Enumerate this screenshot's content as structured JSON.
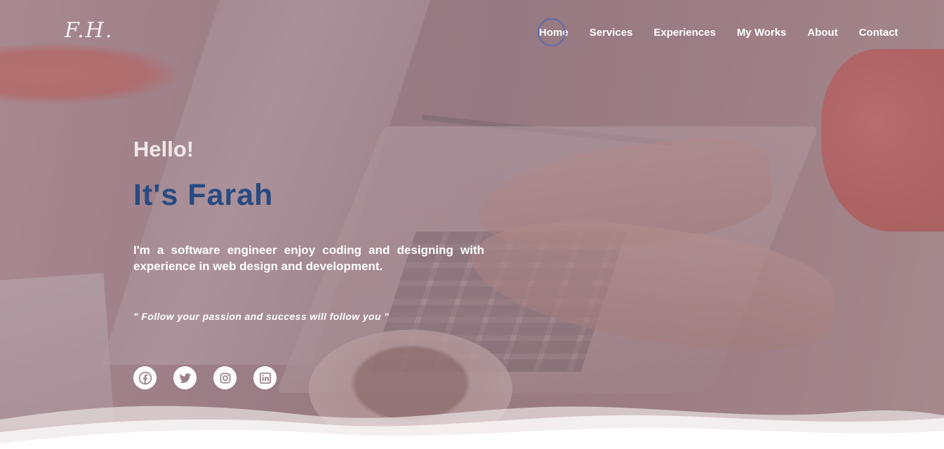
{
  "header": {
    "logo": "F.H.",
    "nav": [
      {
        "label": "Home",
        "active": true
      },
      {
        "label": "Services"
      },
      {
        "label": "Experiences"
      },
      {
        "label": "My Works"
      },
      {
        "label": "About"
      },
      {
        "label": "Contact"
      }
    ]
  },
  "hero": {
    "greeting": "Hello!",
    "name": "It's Farah",
    "intro": "I'm a software engineer enjoy coding and designing with experience in web design and development.",
    "quote": "\" Follow your passion and success will follow you \""
  },
  "socials": [
    {
      "icon": "facebook-icon"
    },
    {
      "icon": "twitter-icon"
    },
    {
      "icon": "instagram-icon"
    },
    {
      "icon": "linkedin-icon"
    }
  ],
  "colors": {
    "accent_name": "#274a82",
    "nav_active_ring": "#5867b4"
  }
}
